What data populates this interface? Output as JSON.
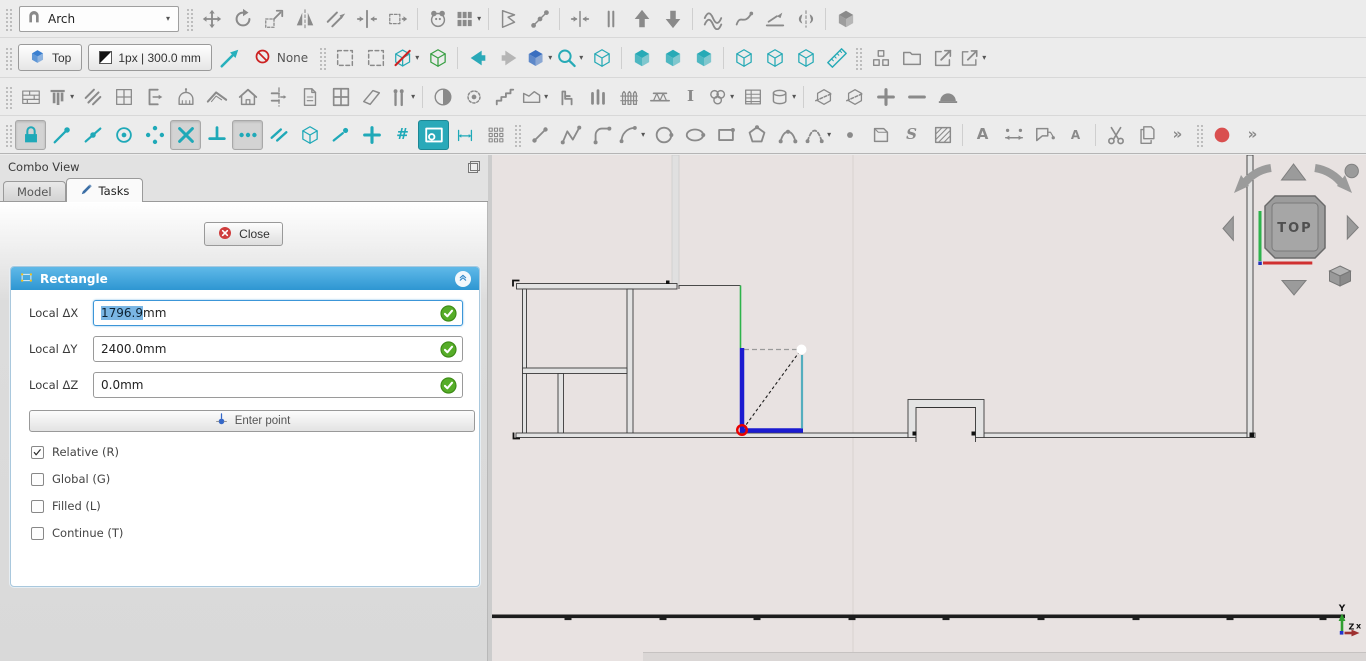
{
  "colors": {
    "accent_blue": "#2e96d2",
    "tool_teal": "#1fa9b8",
    "selection_blue": "#7ab6e4",
    "check_green": "#55ad28",
    "stop_red": "#d94f4f",
    "viewport_bg": "#e8e2e1",
    "draw_blue": "#1b1bd0",
    "draw_cyan": "#54aebe",
    "draw_green": "#2eb34b",
    "snap_marker_red": "#e80000"
  },
  "toolbars": {
    "row1": [
      {
        "k": "grip"
      },
      {
        "k": "combo",
        "n": "workbench-selector",
        "label": "Arch",
        "icon": "arch"
      },
      {
        "k": "grip"
      },
      {
        "n": "draft-move",
        "p": "move"
      },
      {
        "n": "draft-rotate",
        "p": "rotate"
      },
      {
        "n": "draft-scale",
        "p": "scale"
      },
      {
        "n": "draft-mirror",
        "p": "mirror"
      },
      {
        "n": "draft-offset",
        "p": "offset"
      },
      {
        "n": "draft-trimex",
        "p": "trim"
      },
      {
        "n": "draft-stretch",
        "p": "stretch"
      },
      {
        "k": "sep"
      },
      {
        "n": "draft-clone",
        "p": "clone"
      },
      {
        "n": "draft-array",
        "p": "grid3",
        "dd": 1
      },
      {
        "k": "sep"
      },
      {
        "n": "draft-edit",
        "p": "flag"
      },
      {
        "n": "draft-subelement-highlight",
        "p": "nodes"
      },
      {
        "k": "sep"
      },
      {
        "n": "draft-join",
        "p": "join"
      },
      {
        "n": "draft-split",
        "p": "split"
      },
      {
        "n": "draft-upgrade",
        "p": "triup"
      },
      {
        "n": "draft-downgrade",
        "p": "tridown"
      },
      {
        "k": "sep"
      },
      {
        "n": "draft-wire-to-bspline",
        "p": "zigzag"
      },
      {
        "n": "draft-add-point",
        "p": "scribble"
      },
      {
        "n": "draft-slope",
        "p": "slope"
      },
      {
        "n": "draft-flip-direction",
        "p": "flip"
      },
      {
        "k": "sep"
      },
      {
        "n": "draft-shape-2d-view",
        "p": "cubes"
      }
    ],
    "row2": [
      {
        "k": "grip"
      },
      {
        "k": "btn",
        "n": "view-top-button",
        "label": "Top",
        "icon": "cubes",
        "ic": "#3a7fd0"
      },
      {
        "k": "btn",
        "n": "line-style-button",
        "label": "1px | 300.0 mm",
        "icon": "halfsq"
      },
      {
        "n": "apply-current-style",
        "p": "cursor",
        "c": "#27b0bc"
      },
      {
        "k": "autogroup",
        "n": "autogroup-button",
        "label": "None"
      },
      {
        "k": "grip"
      },
      {
        "n": "box-selection",
        "p": "dashrect"
      },
      {
        "n": "box-element-selection",
        "p": "dashrect"
      },
      {
        "n": "snap-toggle",
        "p": "hexslash",
        "c": "#27aab6",
        "dd": 1
      },
      {
        "n": "select-working-plane",
        "p": "cubew",
        "c": "#3aa045"
      },
      {
        "k": "sep"
      },
      {
        "n": "nav-back",
        "p": "trileft",
        "c": "#2aa9b8"
      },
      {
        "n": "nav-forward",
        "p": "triright",
        "c": "#b5b5b5"
      },
      {
        "n": "link-navigate",
        "p": "cubes",
        "c": "#3a6fc0",
        "dd": 1
      },
      {
        "n": "zoom-tools",
        "p": "magnifier",
        "c": "#27aab6",
        "dd": 1
      },
      {
        "n": "view-axonometric",
        "p": "cubew",
        "c": "#27aab6"
      },
      {
        "k": "sep"
      },
      {
        "n": "view-front",
        "p": "cubes",
        "c": "#27aab6"
      },
      {
        "n": "view-top",
        "p": "cubes",
        "c": "#27aab6"
      },
      {
        "n": "view-right",
        "p": "cubes",
        "c": "#27aab6"
      },
      {
        "k": "sep"
      },
      {
        "n": "view-rear",
        "p": "cubew",
        "c": "#27aab6"
      },
      {
        "n": "view-bottom",
        "p": "cubew",
        "c": "#27aab6"
      },
      {
        "n": "view-left",
        "p": "cubew",
        "c": "#27aab6"
      },
      {
        "n": "measure-distance",
        "p": "ruler",
        "c": "#27aab6"
      },
      {
        "k": "grip"
      },
      {
        "n": "create-group",
        "p": "group"
      },
      {
        "n": "open-folder",
        "p": "folder"
      },
      {
        "n": "export-file",
        "p": "export"
      },
      {
        "n": "share-file",
        "p": "export",
        "dd": 1
      }
    ],
    "row3": [
      {
        "k": "grip"
      },
      {
        "n": "arch-wall",
        "p": "bricks"
      },
      {
        "n": "arch-structure",
        "p": "cols",
        "dd": 1
      },
      {
        "n": "arch-rebar",
        "p": "diag2"
      },
      {
        "n": "arch-curtain-wall",
        "p": "grid4"
      },
      {
        "n": "arch-space",
        "p": "spaceL"
      },
      {
        "n": "arch-project",
        "p": "dome"
      },
      {
        "n": "arch-roof",
        "p": "roof"
      },
      {
        "n": "arch-building",
        "p": "house"
      },
      {
        "n": "arch-section-plane",
        "p": "section"
      },
      {
        "n": "arch-reference",
        "p": "refpage"
      },
      {
        "n": "arch-window",
        "p": "wingrid"
      },
      {
        "n": "arch-panel",
        "p": "panel"
      },
      {
        "n": "arch-pipe",
        "p": "pipes",
        "dd": 1
      },
      {
        "k": "sep"
      },
      {
        "n": "arch-axis",
        "p": "halfc"
      },
      {
        "n": "arch-axis-system",
        "p": "gearc"
      },
      {
        "n": "arch-stairs",
        "p": "stairs"
      },
      {
        "n": "arch-wall-tools",
        "p": "walljoin",
        "dd": 1
      },
      {
        "n": "arch-equipment",
        "p": "equip"
      },
      {
        "n": "arch-frame",
        "p": "cols3"
      },
      {
        "n": "arch-fence",
        "p": "fence"
      },
      {
        "n": "arch-truss",
        "p": "truss"
      },
      {
        "n": "arch-profile",
        "g": "I",
        "serif": 1
      },
      {
        "n": "arch-material",
        "p": "circles3",
        "dd": 1
      },
      {
        "n": "arch-schedule",
        "p": "schedule"
      },
      {
        "n": "arch-pipe-connector",
        "p": "cylinder",
        "dd": 1
      },
      {
        "k": "sep"
      },
      {
        "n": "arch-cut-with-plane",
        "p": "cutplane"
      },
      {
        "n": "arch-cut-line",
        "p": "cutplane"
      },
      {
        "n": "arch-add-component",
        "p": "plus"
      },
      {
        "n": "arch-remove-component",
        "p": "minus"
      },
      {
        "n": "arch-survey",
        "p": "helmet"
      }
    ],
    "row4": [
      {
        "k": "grip"
      },
      {
        "n": "snap-lock",
        "p": "lock",
        "c": "#1fa9b8",
        "pr": 1
      },
      {
        "n": "snap-endpoint",
        "p": "snapend",
        "c": "#1fa9b8"
      },
      {
        "n": "snap-midpoint",
        "p": "snapmid",
        "c": "#1fa9b8"
      },
      {
        "n": "snap-center",
        "p": "ring2",
        "c": "#1fa9b8"
      },
      {
        "n": "snap-angle",
        "p": "angles",
        "c": "#1fa9b8"
      },
      {
        "n": "snap-intersection",
        "p": "crossx",
        "c": "#1fa9b8",
        "pr": 1
      },
      {
        "n": "snap-perpendicular",
        "p": "perp",
        "c": "#1fa9b8"
      },
      {
        "n": "snap-extension",
        "p": "dots3",
        "c": "#1fa9b8",
        "pr": 1
      },
      {
        "n": "snap-parallel",
        "p": "par2",
        "c": "#1fa9b8"
      },
      {
        "n": "snap-special",
        "p": "cubew",
        "c": "#1fa9b8"
      },
      {
        "n": "snap-near",
        "p": "near",
        "c": "#1fa9b8"
      },
      {
        "n": "snap-ortho",
        "p": "plus",
        "c": "#1fa9b8"
      },
      {
        "n": "snap-grid",
        "g": "#",
        "c": "#1fa9b8"
      },
      {
        "n": "snap-working-plane",
        "p": "wpsnap",
        "c": "#ffffff",
        "teal": 1
      },
      {
        "n": "snap-dimensions",
        "p": "dimsnap",
        "c": "#1fa9b8"
      },
      {
        "n": "toggle-grid",
        "p": "matrix"
      },
      {
        "k": "grip"
      },
      {
        "n": "draft-line",
        "p": "dline"
      },
      {
        "n": "draft-wire",
        "p": "dwire"
      },
      {
        "n": "draft-fillet",
        "p": "dfillet"
      },
      {
        "n": "draft-arc",
        "p": "darc",
        "dd": 1
      },
      {
        "n": "draft-circle",
        "p": "dcircle"
      },
      {
        "n": "draft-ellipse",
        "p": "dellipse"
      },
      {
        "n": "draft-rectangle",
        "p": "drect"
      },
      {
        "n": "draft-polygon",
        "p": "dpoly"
      },
      {
        "n": "draft-bspline",
        "p": "dbspline"
      },
      {
        "n": "draft-bezier",
        "p": "dbezier",
        "dd": 1
      },
      {
        "n": "draft-point",
        "p": "dot"
      },
      {
        "n": "draft-facebinder",
        "p": "fbind"
      },
      {
        "n": "draft-shapestring",
        "g": "S",
        "serif": 1,
        "italic": 1
      },
      {
        "n": "draft-hatch",
        "p": "hatch"
      },
      {
        "k": "sep"
      },
      {
        "n": "draft-text",
        "g": "A"
      },
      {
        "n": "draft-dimension",
        "p": "dimension"
      },
      {
        "n": "draft-label",
        "p": "labeltag"
      },
      {
        "n": "annotation-styles",
        "g": "A",
        "small": 1
      },
      {
        "k": "sep"
      },
      {
        "n": "cut",
        "p": "scissors"
      },
      {
        "n": "copy",
        "p": "copy"
      },
      {
        "n": "toolbar-overflow",
        "g": "»"
      },
      {
        "k": "grip"
      },
      {
        "n": "stop-macro-recording",
        "p": "reddot",
        "c": "#d94f4f"
      },
      {
        "n": "toolbar-overflow-2",
        "g": "»"
      }
    ]
  },
  "panel": {
    "title": "Combo View",
    "tabs": [
      {
        "label": "Model",
        "active": false
      },
      {
        "label": "Tasks",
        "active": true
      }
    ],
    "close_label": "Close",
    "section": {
      "title": "Rectangle",
      "fields": [
        {
          "key": "local-dx",
          "label": "Local ΔX",
          "value": "1796.9",
          "suffix": " mm",
          "selected": true,
          "focused": true,
          "valid": true
        },
        {
          "key": "local-dy",
          "label": "Local ΔY",
          "value": "2400.0",
          "suffix": " mm",
          "selected": false,
          "focused": false,
          "valid": true
        },
        {
          "key": "local-dz",
          "label": "Local ΔZ",
          "value": "0.0",
          "suffix": " mm",
          "selected": false,
          "focused": false,
          "valid": true
        }
      ],
      "enter_point_label": "Enter point",
      "checkboxes": [
        {
          "key": "relative",
          "label": "Relative (R)",
          "checked": true
        },
        {
          "key": "global",
          "label": "Global (G)",
          "checked": false
        },
        {
          "key": "filled",
          "label": "Filled (L)",
          "checked": false
        },
        {
          "key": "continue",
          "label": "Continue (T)",
          "checked": false
        }
      ]
    }
  },
  "viewport": {
    "nav_cube_label": "TOP",
    "axis_labels": {
      "y": "Y",
      "z": "Z",
      "x": "x"
    }
  }
}
